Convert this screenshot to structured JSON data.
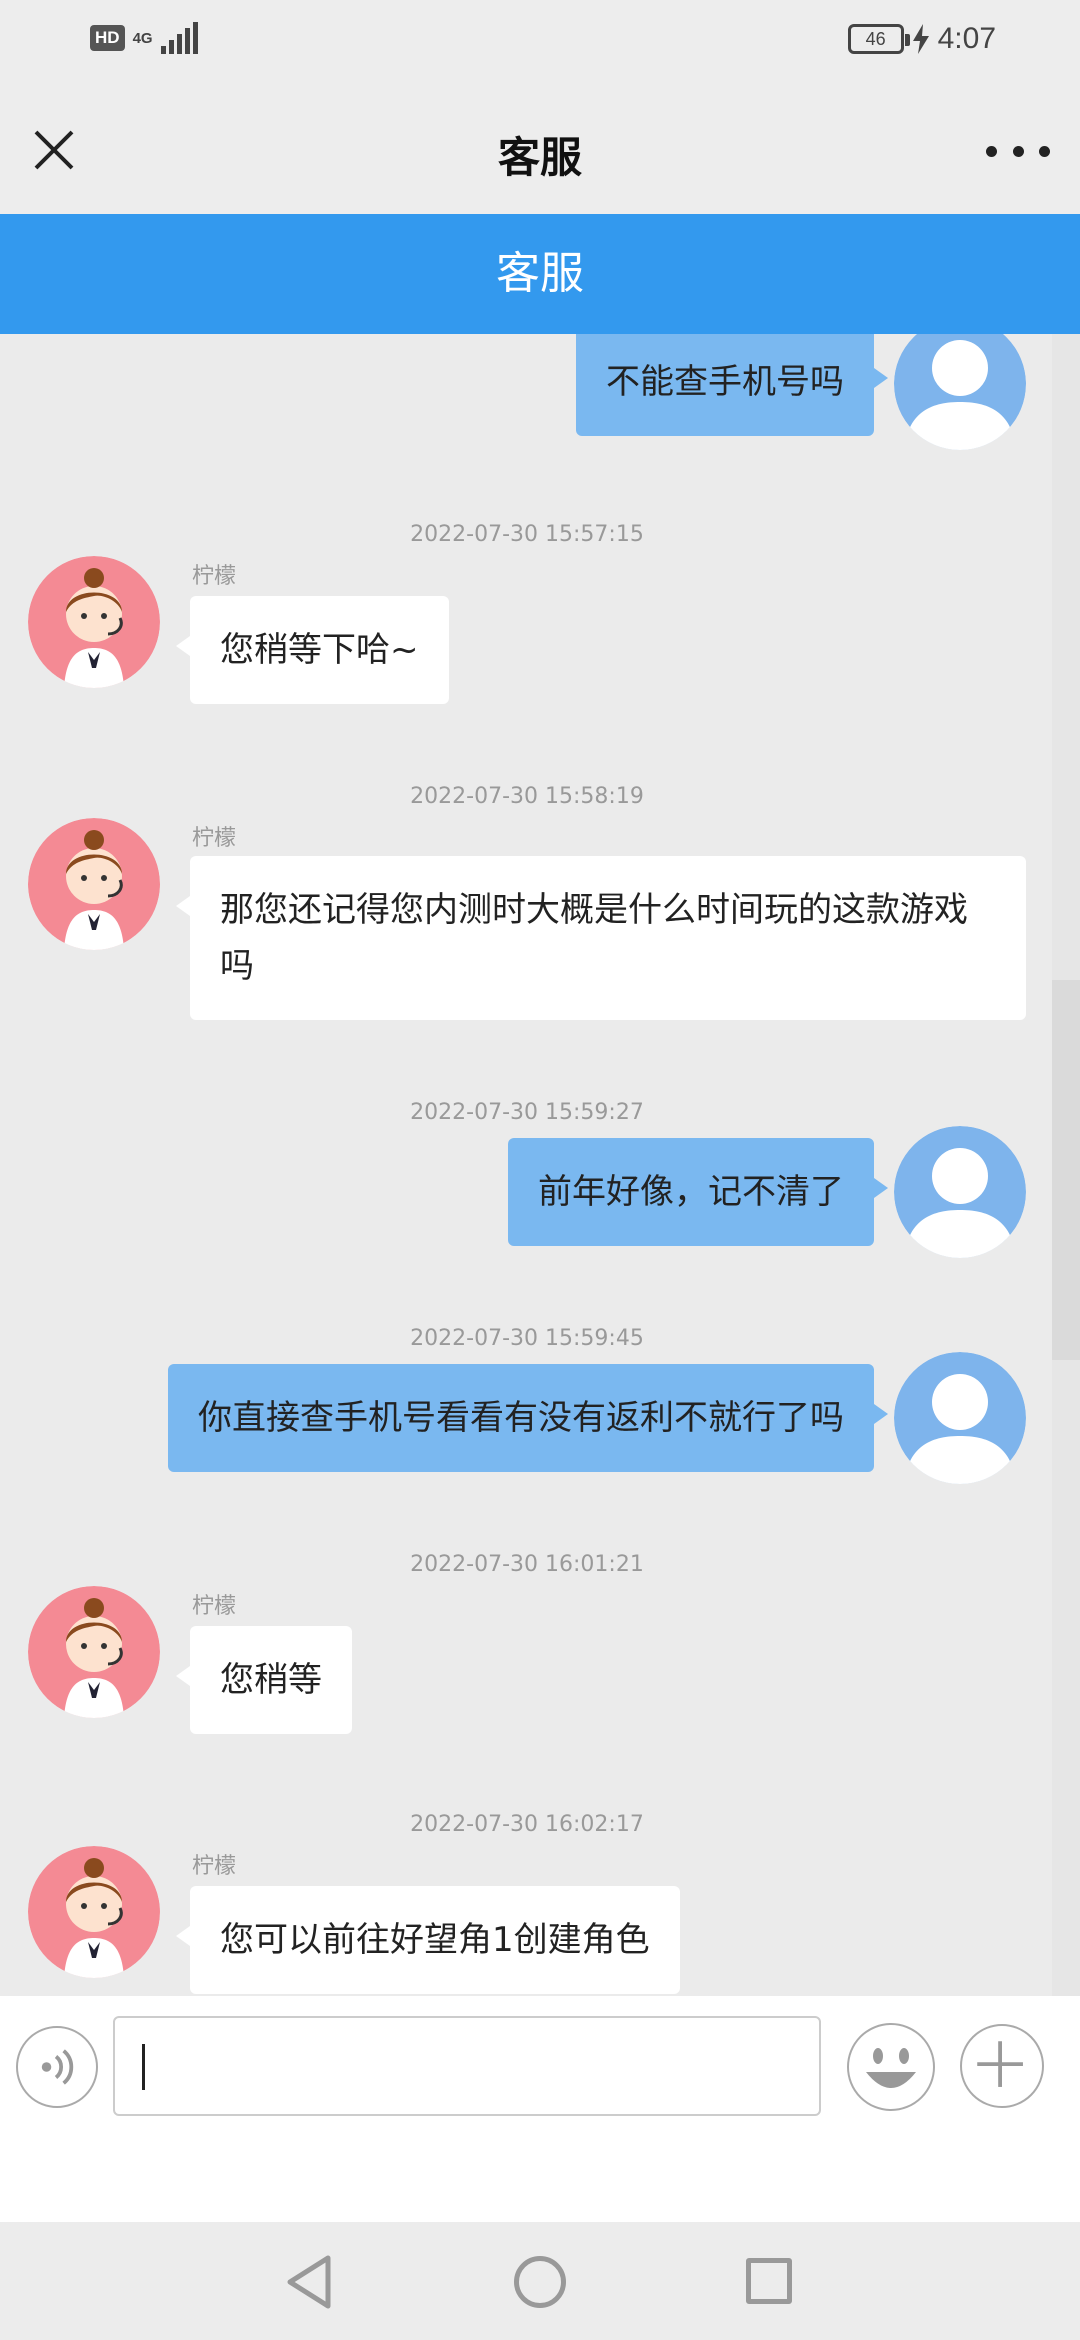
{
  "status_bar": {
    "hd": "HD",
    "network": "4G",
    "battery": "46",
    "time": "4:07"
  },
  "title_bar": {
    "title": "客服"
  },
  "header": {
    "title": "客服"
  },
  "messages": [
    {
      "side": "right",
      "text": "不能查手机号吗"
    },
    {
      "side": "left",
      "timestamp": "2022-07-30 15:57:15",
      "sender": "柠檬",
      "text": "您稍等下哈~"
    },
    {
      "side": "left",
      "timestamp": "2022-07-30 15:58:19",
      "sender": "柠檬",
      "text": "那您还记得您内测时大概是什么时间玩的这款游戏吗"
    },
    {
      "side": "right",
      "timestamp": "2022-07-30 15:59:27",
      "text": "前年好像，记不清了"
    },
    {
      "side": "right",
      "timestamp": "2022-07-30 15:59:45",
      "text": "你直接查手机号看看有没有返利不就行了吗"
    },
    {
      "side": "left",
      "timestamp": "2022-07-30 16:01:21",
      "sender": "柠檬",
      "text": "您稍等"
    },
    {
      "side": "left",
      "timestamp": "2022-07-30 16:02:17",
      "sender": "柠檬",
      "text": "您可以前往好望角1创建角色"
    }
  ],
  "input": {
    "value": "",
    "placeholder": ""
  },
  "colors": {
    "header_blue": "#3399ee",
    "user_bubble": "#7ab8f0",
    "agent_avatar_bg": "#f48a94",
    "user_avatar_bg": "#7eb4ec"
  },
  "icons": [
    "close-icon",
    "more-icon",
    "voice-icon",
    "emoji-icon",
    "plus-icon",
    "back-nav-icon",
    "home-nav-icon",
    "recent-apps-icon"
  ]
}
